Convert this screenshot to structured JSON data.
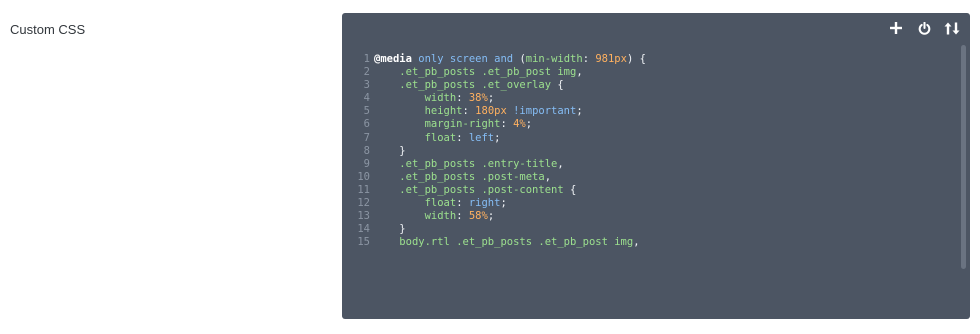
{
  "field": {
    "label": "Custom CSS"
  },
  "toolbar": {
    "icons": [
      "plus-icon",
      "power-icon",
      "sort-arrows-icon"
    ]
  },
  "colors": {
    "editor_bg": "#4c5563",
    "gutter": "#8b95a3",
    "selector": "#9ce08e",
    "value": "#ffb160",
    "keyword": "#85bdf5"
  },
  "code": {
    "lines": [
      {
        "n": "1",
        "tokens": [
          [
            "at",
            "@media"
          ],
          [
            "p",
            " "
          ],
          [
            "kw",
            "only"
          ],
          [
            "p",
            " "
          ],
          [
            "kw",
            "screen"
          ],
          [
            "p",
            " "
          ],
          [
            "kw",
            "and"
          ],
          [
            "p",
            " ("
          ],
          [
            "prop",
            "min-width"
          ],
          [
            "p",
            ": "
          ],
          [
            "num",
            "981px"
          ],
          [
            "p",
            ") {"
          ]
        ]
      },
      {
        "n": "2",
        "tokens": [
          [
            "p",
            "    "
          ],
          [
            "sel",
            ".et_pb_posts .et_pb_post img"
          ],
          [
            "p",
            ","
          ]
        ]
      },
      {
        "n": "3",
        "tokens": [
          [
            "p",
            "    "
          ],
          [
            "sel",
            ".et_pb_posts .et_overlay"
          ],
          [
            "p",
            " {"
          ]
        ]
      },
      {
        "n": "4",
        "tokens": [
          [
            "p",
            "        "
          ],
          [
            "prop",
            "width"
          ],
          [
            "p",
            ": "
          ],
          [
            "num",
            "38%"
          ],
          [
            "p",
            ";"
          ]
        ]
      },
      {
        "n": "5",
        "tokens": [
          [
            "p",
            "        "
          ],
          [
            "prop",
            "height"
          ],
          [
            "p",
            ": "
          ],
          [
            "num",
            "180px"
          ],
          [
            "p",
            " "
          ],
          [
            "imp",
            "!important"
          ],
          [
            "p",
            ";"
          ]
        ]
      },
      {
        "n": "6",
        "tokens": [
          [
            "p",
            "        "
          ],
          [
            "prop",
            "margin-right"
          ],
          [
            "p",
            ": "
          ],
          [
            "num",
            "4%"
          ],
          [
            "p",
            ";"
          ]
        ]
      },
      {
        "n": "7",
        "tokens": [
          [
            "p",
            "        "
          ],
          [
            "prop",
            "float"
          ],
          [
            "p",
            ": "
          ],
          [
            "kw",
            "left"
          ],
          [
            "p",
            ";"
          ]
        ]
      },
      {
        "n": "8",
        "tokens": [
          [
            "p",
            "    }"
          ]
        ]
      },
      {
        "n": "9",
        "tokens": [
          [
            "p",
            "    "
          ],
          [
            "sel",
            ".et_pb_posts .entry-title"
          ],
          [
            "p",
            ","
          ]
        ]
      },
      {
        "n": "10",
        "tokens": [
          [
            "p",
            "    "
          ],
          [
            "sel",
            ".et_pb_posts .post-meta"
          ],
          [
            "p",
            ","
          ]
        ]
      },
      {
        "n": "11",
        "tokens": [
          [
            "p",
            "    "
          ],
          [
            "sel",
            ".et_pb_posts .post-content"
          ],
          [
            "p",
            " {"
          ]
        ]
      },
      {
        "n": "12",
        "tokens": [
          [
            "p",
            "        "
          ],
          [
            "prop",
            "float"
          ],
          [
            "p",
            ": "
          ],
          [
            "kw",
            "right"
          ],
          [
            "p",
            ";"
          ]
        ]
      },
      {
        "n": "13",
        "tokens": [
          [
            "p",
            "        "
          ],
          [
            "prop",
            "width"
          ],
          [
            "p",
            ": "
          ],
          [
            "num",
            "58%"
          ],
          [
            "p",
            ";"
          ]
        ]
      },
      {
        "n": "14",
        "tokens": [
          [
            "p",
            "    }"
          ]
        ]
      },
      {
        "n": "15",
        "tokens": [
          [
            "p",
            "    "
          ],
          [
            "sel",
            "body.rtl .et_pb_posts .et_pb_post img"
          ],
          [
            "p",
            ","
          ]
        ]
      }
    ]
  }
}
